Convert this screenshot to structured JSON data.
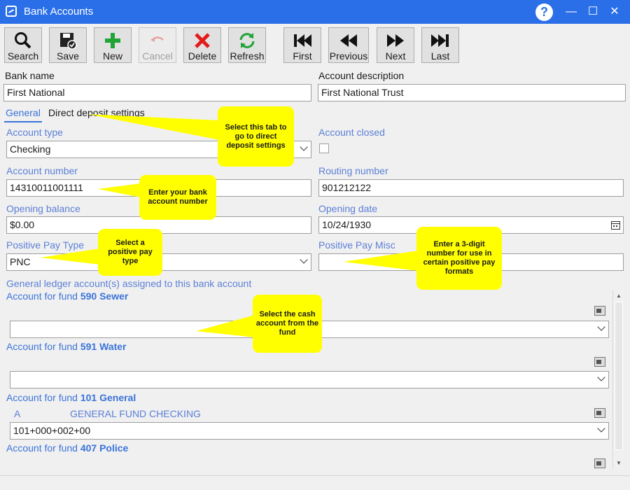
{
  "window": {
    "title": "Bank Accounts",
    "help_label": "?",
    "minimize": "—",
    "maximize": "☐",
    "close": "✕"
  },
  "toolbar": {
    "search": "Search",
    "save": "Save",
    "new": "New",
    "cancel": "Cancel",
    "delete": "Delete",
    "refresh": "Refresh",
    "first": "First",
    "previous": "Previous",
    "next": "Next",
    "last": "Last"
  },
  "form": {
    "bank_name_label": "Bank name",
    "bank_name": "First National",
    "account_description_label": "Account description",
    "account_description": "First National Trust"
  },
  "tabs": {
    "general": "General",
    "direct_deposit": "Direct deposit settings"
  },
  "general": {
    "account_type_label": "Account type",
    "account_type": "Checking",
    "account_closed_label": "Account closed",
    "account_number_label": "Account number",
    "account_number": "14310011001111",
    "routing_number_label": "Routing number",
    "routing_number": "901212122",
    "opening_balance_label": "Opening balance",
    "opening_balance": "$0.00",
    "opening_date_label": "Opening date",
    "opening_date": "10/24/1930",
    "positive_pay_type_label": "Positive Pay Type",
    "positive_pay_type": "PNC",
    "positive_pay_misc_label": "Positive Pay Misc",
    "positive_pay_misc": "",
    "gl_header": "General ledger account(s) assigned to this bank account"
  },
  "funds": [
    {
      "prefix": "Account for fund",
      "number": "590 Sewer",
      "code": "",
      "name": "",
      "account": ""
    },
    {
      "prefix": "Account for fund",
      "number": "591 Water",
      "code": "",
      "name": "",
      "account": ""
    },
    {
      "prefix": "Account for fund",
      "number": "101 General",
      "code": "A",
      "name": "GENERAL FUND CHECKING",
      "account": "101+000+002+00"
    },
    {
      "prefix": "Account for fund",
      "number": "407 Police",
      "code": "",
      "name": "",
      "account": ""
    }
  ],
  "callouts": {
    "tab": "Select this tab to go to direct deposit settings",
    "account_number": "Enter your bank account number",
    "positive_pay": "Select a positive pay type",
    "positive_misc": "Enter a 3-digit number for use in certain positive pay formats",
    "cash_account": "Select the cash account from the fund"
  },
  "colors": {
    "titlebar": "#2a6fe8",
    "label_blue": "#5b7fd6",
    "link_blue": "#3a73d9",
    "callout": "#ffff00"
  }
}
